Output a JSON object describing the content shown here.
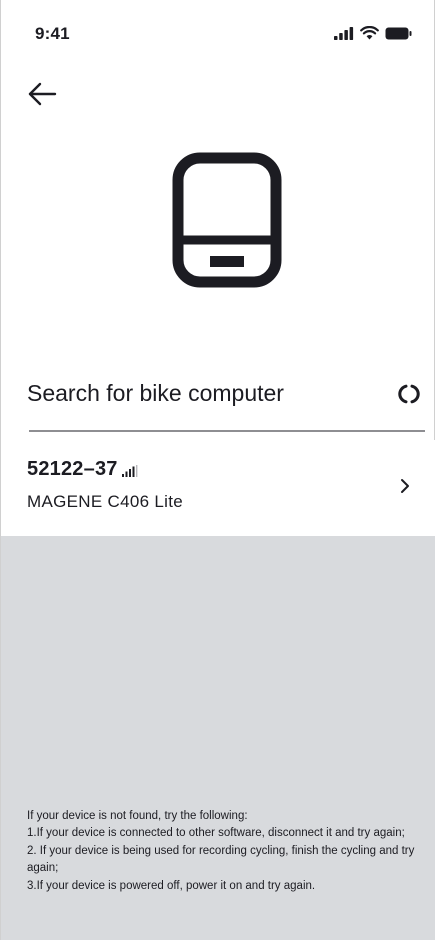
{
  "status_bar": {
    "time": "9:41"
  },
  "icons": {
    "back": "arrow-left-icon",
    "device": "bike-computer-icon",
    "refresh": "refresh-icon",
    "signal": "signal-strength-icon",
    "chevron": "chevron-right-icon"
  },
  "search": {
    "title": "Search for bike computer"
  },
  "devices": [
    {
      "id": "52122–37",
      "model": "MAGENE C406 Lite"
    }
  ],
  "tips": {
    "heading": "If your device is not found, try the following:",
    "items": [
      "1.If your device is connected to other software, disconnect it and try again;",
      "2. If your device is being used for recording cycling, finish the cycling and try again;",
      "3.If your device is powered off, power it on and try again."
    ]
  },
  "colors": {
    "text": "#1c1c22",
    "gray_background": "#d8dadd",
    "divider": "#8e8e92"
  }
}
